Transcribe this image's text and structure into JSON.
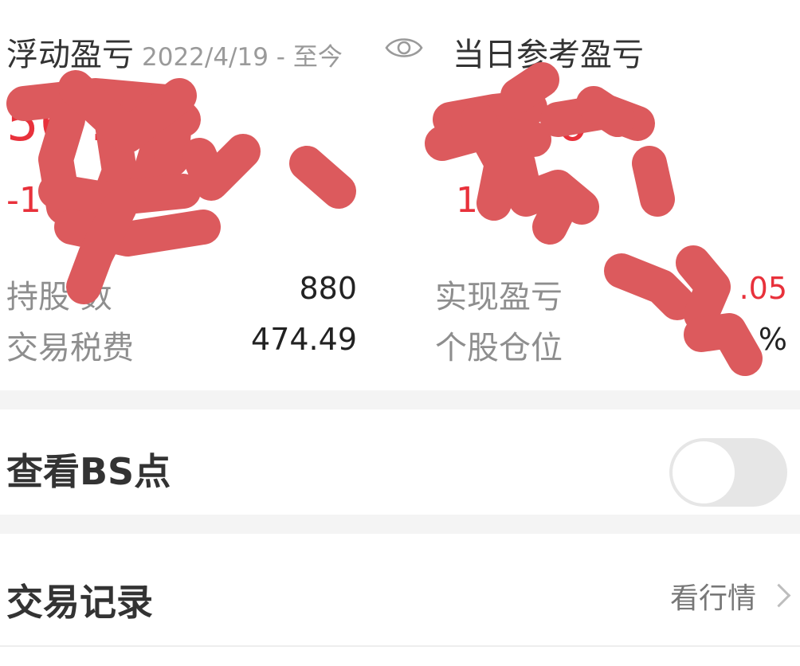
{
  "header": {
    "floating_pl_label": "浮动盈亏",
    "date_range": "2022/4/19 - 至今",
    "daily_ref_pl_label": "当日参考盈亏",
    "visibility_icon": "eye-icon"
  },
  "floating": {
    "amount_visible": "56 .47",
    "percent_visible": "-1 %"
  },
  "daily": {
    "amount_visible": "1 .00",
    "percent_visible": "1"
  },
  "stats": {
    "holding_label": "持股 数",
    "holding_value": "880",
    "tax_label": "交易税费",
    "tax_value": "474.49",
    "realized_label": "实现盈亏",
    "realized_value": ".05",
    "position_label": "个股仓位",
    "position_value": "%"
  },
  "bs": {
    "label": "查看BS点",
    "toggle_state": "off"
  },
  "trade": {
    "label": "交易记录",
    "link_label": "看行情"
  },
  "colors": {
    "red": "#e8313b",
    "scribble": "#dc5a5d",
    "toggle_off": "#e6e6e6"
  }
}
